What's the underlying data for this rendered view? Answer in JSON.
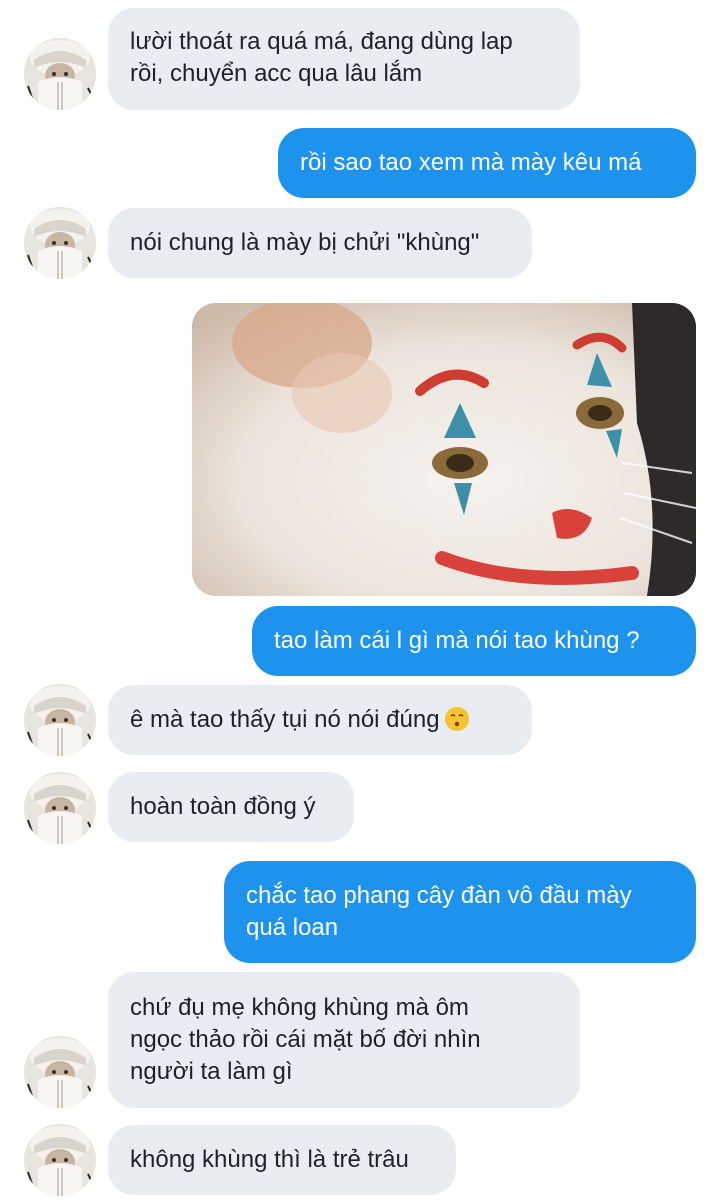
{
  "messages": [
    {
      "sender": "them",
      "lines": [
        "lười thoát ra quá má, đang dùng lap",
        "rồi, chuyển acc qua lâu lắm"
      ]
    },
    {
      "sender": "me",
      "lines": [
        "rồi sao tao xem mà mày kêu má"
      ]
    },
    {
      "sender": "them",
      "lines": [
        "nói chung là mày bị chửi \"khùng\""
      ]
    },
    {
      "sender": "me",
      "type": "image",
      "image": "clown-cat-photo"
    },
    {
      "sender": "me",
      "lines": [
        "tao làm cái l gì mà nói tao khùng ?"
      ]
    },
    {
      "sender": "them",
      "lines": [
        "ê mà tao thấy tụi nó nói đúng"
      ],
      "emoji": "kissing-face-emoji"
    },
    {
      "sender": "them",
      "lines": [
        "hoàn toàn đồng ý"
      ]
    },
    {
      "sender": "me",
      "lines": [
        "chắc tao phang cây đàn vô đầu mày",
        "quá loan"
      ]
    },
    {
      "sender": "them",
      "lines": [
        "chứ đụ mẹ không khùng mà ôm",
        "ngọc thảo rồi cái mặt bố đời nhìn",
        "người ta làm gì"
      ]
    },
    {
      "sender": "them",
      "lines": [
        "không khùng thì là trẻ trâu"
      ]
    }
  ],
  "colors": {
    "incoming_bubble": "#e9ecf1",
    "outgoing_bubble": "#1e93ee",
    "incoming_text": "#1e2128",
    "outgoing_text": "#ffffff"
  }
}
